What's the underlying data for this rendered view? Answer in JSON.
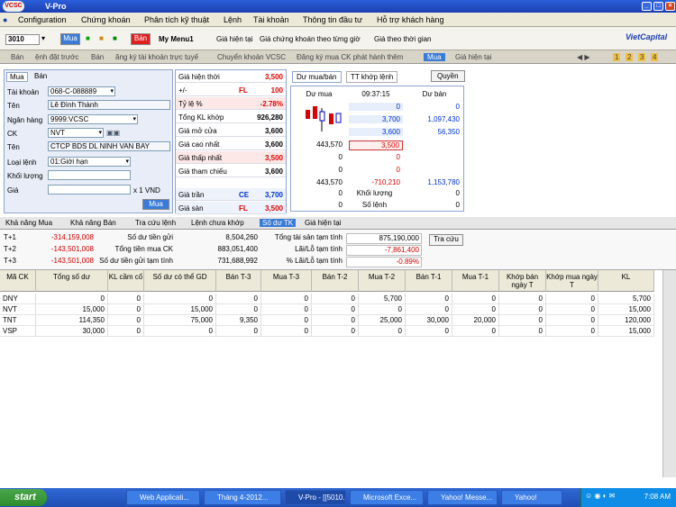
{
  "window": {
    "title": "V-Pro",
    "logo": "VCSC"
  },
  "menu": [
    "Configuration",
    "Chứng khoán",
    "Phân tích kỹ thuật",
    "Lệnh",
    "Tài khoản",
    "Thông tin đầu tư",
    "Hỗ trợ khách hàng"
  ],
  "toolbar": {
    "symbol_input": "3010",
    "buy": "Mua",
    "sell": "Bán",
    "mymenu": "My Menu1",
    "links": [
      "Giá hiện tại",
      "Giá chứng khoán theo từng giờ",
      "Giá theo thời gian"
    ],
    "brand": "VietCapital",
    "pages": [
      "1",
      "2",
      "3",
      "4"
    ]
  },
  "tabstrip": [
    "Bán",
    "ệnh đặt trước",
    "Bán",
    "ăng ký tài khoản trực tuyế",
    "Chuyển khoản VCSC",
    "Đăng ký mua CK phát hành thêm",
    "Mua",
    "Giá hiện tại"
  ],
  "order": {
    "tabs": [
      "Mua",
      "Bán"
    ],
    "account_label": "Tài khoản",
    "account": "068-C-088889",
    "name_label": "Tên",
    "name": "Lê Đình Thành",
    "bank_label": "Ngân hàng",
    "bank": "9999:VCSC",
    "ck_label": "CK",
    "ck": "NVT",
    "ck_name_label": "Tên",
    "ck_name": "CTCP BDS DL NINH VAN BAY",
    "type_label": "Loại lệnh",
    "type": "01:Giới hạn",
    "qty_label": "Khối lượng",
    "qty": "",
    "price_label": "Giá",
    "price": "",
    "unit": "x 1 VND",
    "submit": "Mua"
  },
  "quote": {
    "rows": [
      {
        "k": "Giá hiện thời",
        "v": "3,500",
        "c": "red"
      },
      {
        "k": "+/-",
        "v": "100",
        "tag": "FL",
        "c": "red"
      },
      {
        "k": "Tỷ lệ %",
        "v": "-2.78%",
        "c": "red"
      },
      {
        "k": "Tổng KL khớp",
        "v": "926,280",
        "c": ""
      },
      {
        "k": "Giá mở cửa",
        "v": "3,600",
        "c": ""
      },
      {
        "k": "Giá cao nhất",
        "v": "3,600",
        "c": ""
      },
      {
        "k": "Giá thấp nhất",
        "v": "3,500",
        "c": "red"
      },
      {
        "k": "Giá tham chiếu",
        "v": "3,600",
        "c": ""
      }
    ],
    "ceil_label": "Giá trần",
    "ceil_tag": "CE",
    "ceil": "3,700",
    "floor_label": "Giá sàn",
    "floor_tag": "FL",
    "floor": "3,500"
  },
  "orderbook": {
    "tabs": [
      "Dư mua/bán",
      "TT khớp lệnh"
    ],
    "right_btn": "Quyền",
    "headers": [
      "Dư mua",
      "09:37:15",
      "Dư bán"
    ],
    "rows": [
      [
        "",
        "0",
        "0"
      ],
      [
        "",
        "3,700",
        "1,097,430"
      ],
      [
        "",
        "3,600",
        "56,350"
      ],
      [
        "443,570",
        "3,500",
        ""
      ],
      [
        "0",
        "0",
        ""
      ],
      [
        "0",
        "0",
        ""
      ],
      [
        "443,570",
        "-710,210",
        "1,153,780"
      ]
    ],
    "footer": [
      [
        "0",
        "Khối lượng",
        "0"
      ],
      [
        "0",
        "Số lệnh",
        "0"
      ]
    ]
  },
  "summary_tabs": [
    "Khả năng Mua",
    "Khả năng Bán",
    "Tra cứu lệnh",
    "Lệnh chưa khớp",
    "Số dư TK",
    "Giá hiện tại"
  ],
  "summary": {
    "rows": [
      [
        "T+1",
        "-314,159,008",
        "Số dư tiền gửi",
        "8,504,260",
        "Tổng tài sản tạm tính",
        "875,190,000"
      ],
      [
        "T+2",
        "-143,501,008",
        "Tổng tiền mua CK",
        "883,051,400",
        "Lãi/Lỗ tạm tính",
        "-7,861,400"
      ],
      [
        "T+3",
        "-143,501,008",
        "Số dư tiền gửi tạm tính",
        "731,688,992",
        "% Lãi/Lỗ tạm tính",
        "-0.89%"
      ]
    ],
    "lookup": "Tra cứu"
  },
  "grid": {
    "headers": [
      "Mã CK",
      "Tổng số dư",
      "KL cầm cố",
      "Số dư có thể GD",
      "Bán T-3",
      "Mua T-3",
      "Bán T-2",
      "Mua T-2",
      "Bán T-1",
      "Mua T-1",
      "Khớp bán ngày T",
      "Khớp mua ngày T",
      "KL"
    ],
    "rows": [
      [
        "DNY",
        "0",
        "0",
        "0",
        "0",
        "0",
        "0",
        "5,700",
        "0",
        "0",
        "0",
        "0",
        "5,700"
      ],
      [
        "NVT",
        "15,000",
        "0",
        "15,000",
        "0",
        "0",
        "0",
        "0",
        "0",
        "0",
        "0",
        "0",
        "15,000"
      ],
      [
        "TNT",
        "114,350",
        "0",
        "75,000",
        "9,350",
        "0",
        "0",
        "25,000",
        "30,000",
        "20,000",
        "0",
        "0",
        "120,000"
      ],
      [
        "VSP",
        "30,000",
        "0",
        "0",
        "0",
        "0",
        "0",
        "0",
        "0",
        "0",
        "0",
        "0",
        "15,000"
      ]
    ]
  },
  "taskbar": {
    "start": "start",
    "items": [
      "Web Applicati...",
      "Tháng 4-2012...",
      "V-Pro - [[5010...",
      "Microsoft Exce...",
      "Yahoo! Messe...",
      "Yahoo!"
    ],
    "clock": "7:08 AM"
  }
}
